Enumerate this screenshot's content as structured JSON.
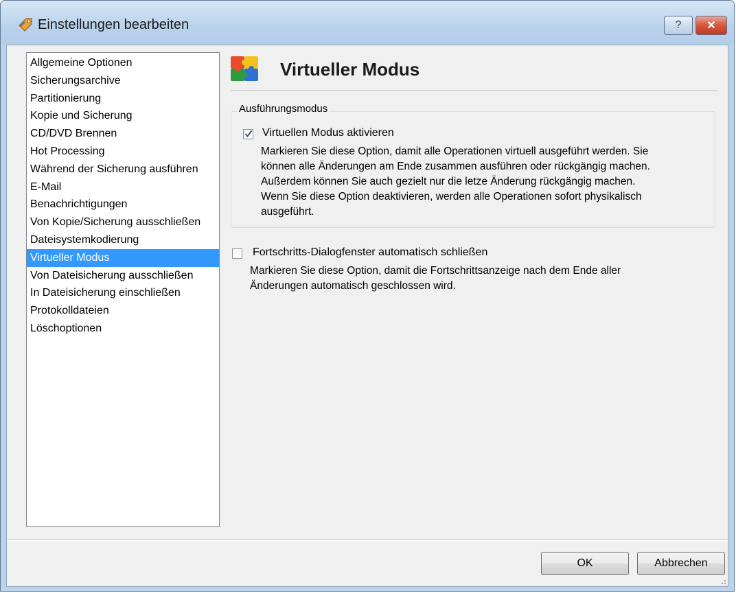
{
  "window": {
    "title": "Einstellungen bearbeiten"
  },
  "titlebar_buttons": {
    "help": "?",
    "close": "✕"
  },
  "sidebar": {
    "items": [
      {
        "label": "Allgemeine Optionen"
      },
      {
        "label": "Sicherungsarchive"
      },
      {
        "label": "Partitionierung"
      },
      {
        "label": "Kopie und Sicherung"
      },
      {
        "label": "CD/DVD Brennen"
      },
      {
        "label": "Hot Processing"
      },
      {
        "label": "Während der Sicherung ausführen"
      },
      {
        "label": "E-Mail"
      },
      {
        "label": "Benachrichtigungen"
      },
      {
        "label": "Von Kopie/Sicherung ausschließen"
      },
      {
        "label": "Dateisystemkodierung"
      },
      {
        "label": "Virtueller Modus",
        "selected": true
      },
      {
        "label": "Von Dateisicherung ausschließen"
      },
      {
        "label": "In Dateisicherung einschließen"
      },
      {
        "label": "Protokolldateien"
      },
      {
        "label": "Löschoptionen"
      }
    ]
  },
  "page": {
    "title": "Virtueller Modus",
    "icon": "puzzle-icon",
    "group_title": "Ausführungsmodus",
    "option1": {
      "label": "Virtuellen Modus aktivieren",
      "checked": true,
      "description_lines": [
        "Markieren Sie diese Option, damit alle Operationen virtuell ausgeführt werden. Sie",
        "können alle Änderungen am Ende zusammen ausführen oder rückgängig machen.",
        "Außerdem können Sie auch gezielt nur die letze Änderung rückgängig machen.",
        "Wenn Sie diese Option deaktivieren, werden alle Operationen sofort physikalisch",
        "ausgeführt."
      ]
    },
    "option2": {
      "label": "Fortschritts-Dialogfenster automatisch schließen",
      "checked": false,
      "description_lines": [
        "Markieren Sie diese Option, damit die Fortschrittsanzeige nach dem Ende aller",
        "Änderungen automatisch geschlossen wird."
      ]
    }
  },
  "buttons": {
    "ok": "OK",
    "cancel": "Abbrechen"
  },
  "colors": {
    "selection": "#3399ff",
    "titlebar": "#b9d2ec",
    "close": "#c23a22"
  }
}
